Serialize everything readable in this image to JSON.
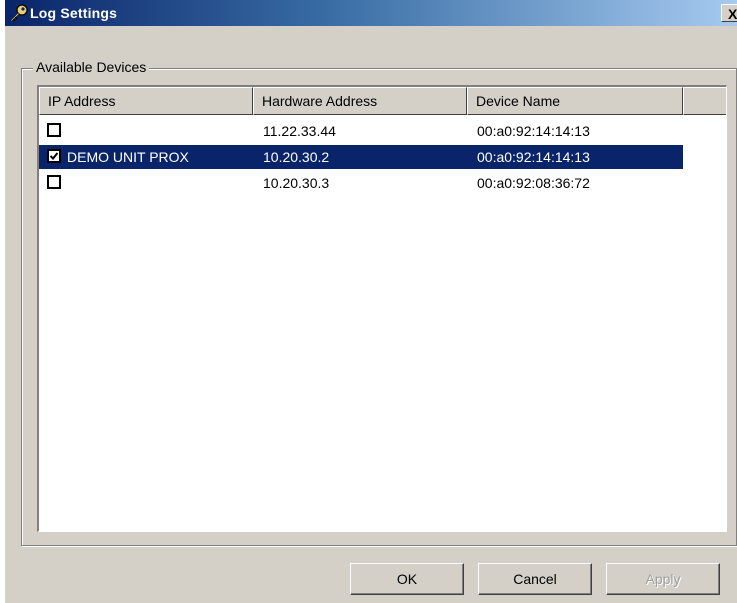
{
  "window": {
    "title": "Log Settings",
    "close_label": "X"
  },
  "group": {
    "label": "Available Devices"
  },
  "table": {
    "columns": [
      "IP Address",
      "Hardware Address",
      "Device Name",
      ""
    ],
    "rows": [
      {
        "checked": false,
        "ip": "",
        "hardware": "11.22.33.44",
        "device": "00:a0:92:14:14:13",
        "selected": false
      },
      {
        "checked": true,
        "ip": "DEMO UNIT PROX",
        "hardware": "10.20.30.2",
        "device": "00:a0:92:14:14:13",
        "selected": true
      },
      {
        "checked": false,
        "ip": "",
        "hardware": "10.20.30.3",
        "device": "00:a0:92:08:36:72",
        "selected": false
      }
    ]
  },
  "buttons": {
    "ok": "OK",
    "cancel": "Cancel",
    "apply": "Apply"
  },
  "colors": {
    "title_gradient_start": "#0a246a",
    "title_gradient_end": "#a6caf0",
    "selection": "#0a246a",
    "face": "#d4d0c8"
  },
  "icons": {
    "title": "key-icon",
    "checkbox_checked": "check-icon"
  }
}
